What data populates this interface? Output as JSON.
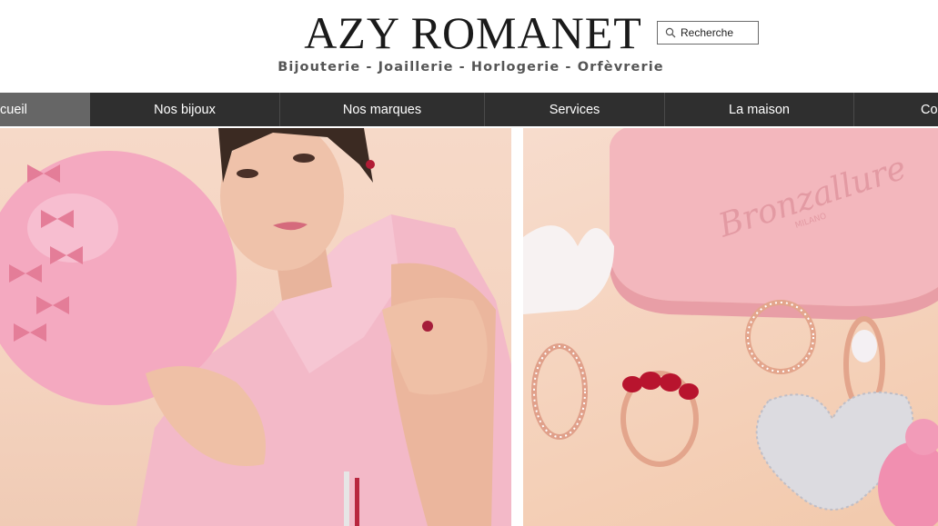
{
  "header": {
    "brand": "AZY ROMANET",
    "tagline": "Bijouterie - Joaillerie - Horlogerie - Orfèvrerie"
  },
  "search": {
    "placeholder": "Recherche",
    "icon": "search-icon"
  },
  "nav": {
    "items": [
      {
        "label": "cueil",
        "active": true
      },
      {
        "label": "Nos bijoux",
        "active": false
      },
      {
        "label": "Nos marques",
        "active": false
      },
      {
        "label": "Services",
        "active": false
      },
      {
        "label": "La maison",
        "active": false
      },
      {
        "label": "Co",
        "active": false
      }
    ]
  },
  "hero": {
    "left_image": "woman-pink-balloon-photo",
    "right_image": "rings-heart-jewelry-photo",
    "box_engraving": "Bronzallure",
    "box_engraving_sub": "MILANO"
  },
  "colors": {
    "nav_bg": "#2f2f2f",
    "nav_active": "#666666",
    "nav_text": "#ffffff",
    "peach_bg": "#f5d6c4",
    "pink": "#f2b6c6"
  }
}
